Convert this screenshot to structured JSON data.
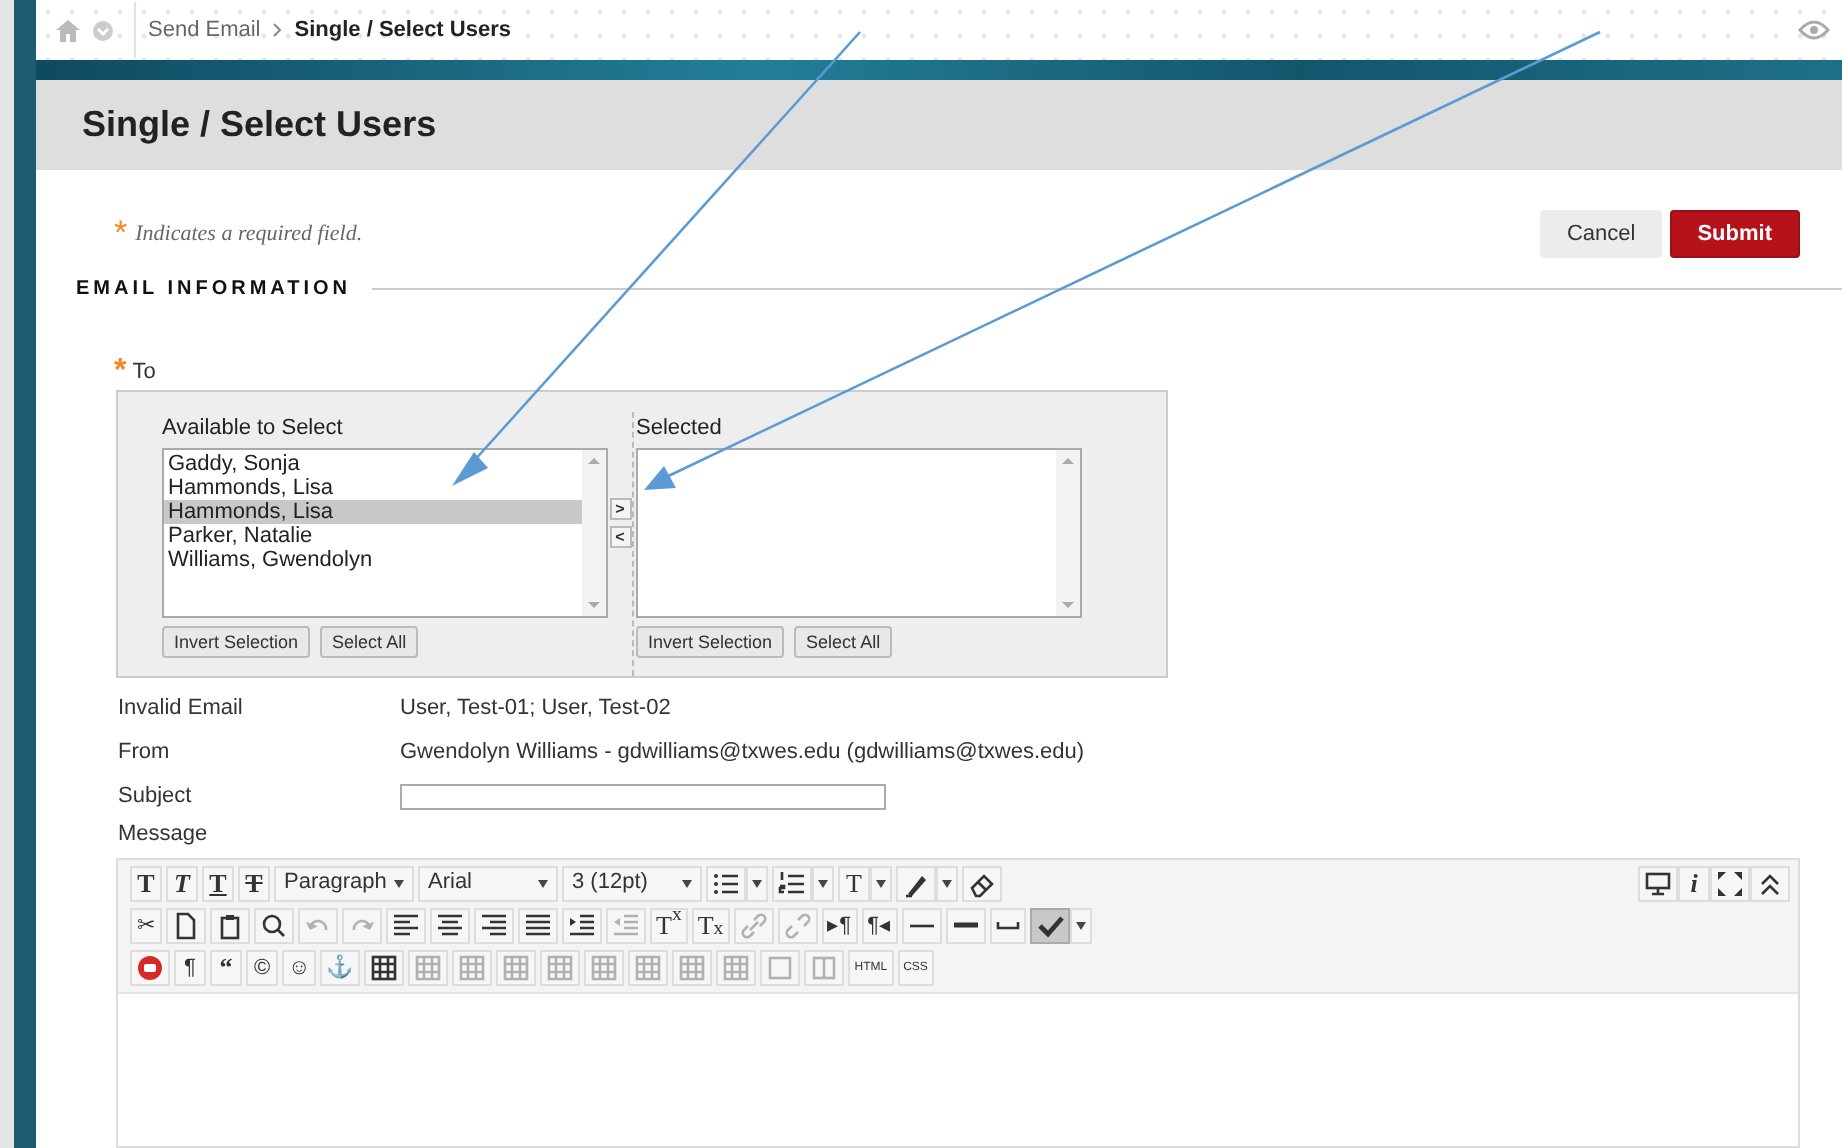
{
  "breadcrumb": [
    {
      "label": "Send Email",
      "current": false
    },
    {
      "label": "Single / Select Users",
      "current": true
    }
  ],
  "page_title": "Single / Select Users",
  "required_note": {
    "mark": "*",
    "text": "Indicates a required field."
  },
  "buttons": [
    {
      "label": "Cancel",
      "kind": "secondary"
    },
    {
      "label": "Submit",
      "kind": "primary"
    }
  ],
  "section_title": "EMAIL INFORMATION",
  "to": {
    "mark": "*",
    "label": "To",
    "available": {
      "label": "Available to Select",
      "items": [
        {
          "label": "Gaddy, Sonja",
          "selected": false
        },
        {
          "label": "Hammonds, Lisa",
          "selected": false
        },
        {
          "label": "Hammonds, Lisa",
          "selected": true
        },
        {
          "label": "Parker, Natalie",
          "selected": false
        },
        {
          "label": "Williams, Gwendolyn",
          "selected": false
        }
      ],
      "buttons": [
        "Invert Selection",
        "Select All"
      ]
    },
    "move_buttons": [
      ">",
      "<"
    ],
    "selected": {
      "label": "Selected",
      "buttons": [
        "Invert Selection",
        "Select All"
      ]
    }
  },
  "fields": [
    {
      "label": "Invalid Email",
      "kind": "text",
      "value": "User, Test-01; User, Test-02"
    },
    {
      "label": "From",
      "kind": "text",
      "value": "Gwendolyn Williams - gdwilliams@txwes.edu (gdwilliams@txwes.edu)"
    },
    {
      "label": "Subject",
      "kind": "input"
    }
  ],
  "message": {
    "label": "Message",
    "toolbar_rows": [
      [
        {
          "kind": "bold",
          "glyph": "T"
        },
        {
          "kind": "italic",
          "glyph": "T"
        },
        {
          "kind": "underline",
          "glyph": "T"
        },
        {
          "kind": "strike",
          "glyph": "T"
        },
        {
          "kind": "select",
          "value": "Paragraph"
        },
        {
          "kind": "select",
          "value": "Arial"
        },
        {
          "kind": "select",
          "value": "3 (12pt)"
        },
        {
          "kind": "bullets",
          "caret": true
        },
        {
          "kind": "numbers",
          "caret": true
        },
        {
          "kind": "serif",
          "glyph": "T",
          "caret": true
        },
        {
          "kind": "highlight",
          "caret": true
        },
        {
          "kind": "eraser"
        }
      ],
      [
        {
          "kind": "glyph",
          "glyph": "✂"
        },
        {
          "kind": "page"
        },
        {
          "kind": "paste"
        },
        {
          "kind": "find"
        },
        {
          "kind": "undo",
          "disabled": true
        },
        {
          "kind": "redo",
          "disabled": true
        },
        {
          "kind": "align-left"
        },
        {
          "kind": "align-center"
        },
        {
          "kind": "align-right"
        },
        {
          "kind": "justify"
        },
        {
          "kind": "indent"
        },
        {
          "kind": "outdent",
          "disabled": true
        },
        {
          "kind": "serif",
          "glyph": "T$^{x}$"
        },
        {
          "kind": "serif",
          "glyph": "T$_{x}$"
        },
        {
          "kind": "link",
          "disabled": true
        },
        {
          "kind": "unlink",
          "disabled": true
        },
        {
          "kind": "glyph",
          "glyph": "▸¶"
        },
        {
          "kind": "glyph",
          "glyph": "¶◂"
        },
        {
          "kind": "hr"
        },
        {
          "kind": "hr-thick"
        },
        {
          "kind": "nbsp"
        },
        {
          "kind": "spellcheck",
          "pressed": true,
          "caret": true
        }
      ],
      [
        {
          "kind": "video"
        },
        {
          "kind": "glyph",
          "glyph": "¶"
        },
        {
          "kind": "bold",
          "glyph": "“"
        },
        {
          "kind": "glyph",
          "glyph": "©"
        },
        {
          "kind": "glyph",
          "glyph": "☺"
        },
        {
          "kind": "glyph",
          "glyph": "⚓"
        },
        {
          "kind": "table"
        },
        {
          "kind": "table",
          "disabled": true
        },
        {
          "kind": "table",
          "disabled": true
        },
        {
          "kind": "table",
          "disabled": true
        },
        {
          "kind": "table",
          "disabled": true
        },
        {
          "kind": "table",
          "disabled": true
        },
        {
          "kind": "table",
          "disabled": true
        },
        {
          "kind": "table",
          "disabled": true
        },
        {
          "kind": "table",
          "disabled": true
        },
        {
          "kind": "cell",
          "disabled": true
        },
        {
          "kind": "split",
          "disabled": true
        },
        {
          "kind": "tiny",
          "glyph": "HTML"
        },
        {
          "kind": "tiny",
          "glyph": "CSS"
        }
      ]
    ],
    "toolbar_right": [
      {
        "kind": "monitor"
      },
      {
        "kind": "info",
        "glyph": "i"
      },
      {
        "kind": "fullscreen"
      },
      {
        "kind": "collapse"
      }
    ]
  }
}
